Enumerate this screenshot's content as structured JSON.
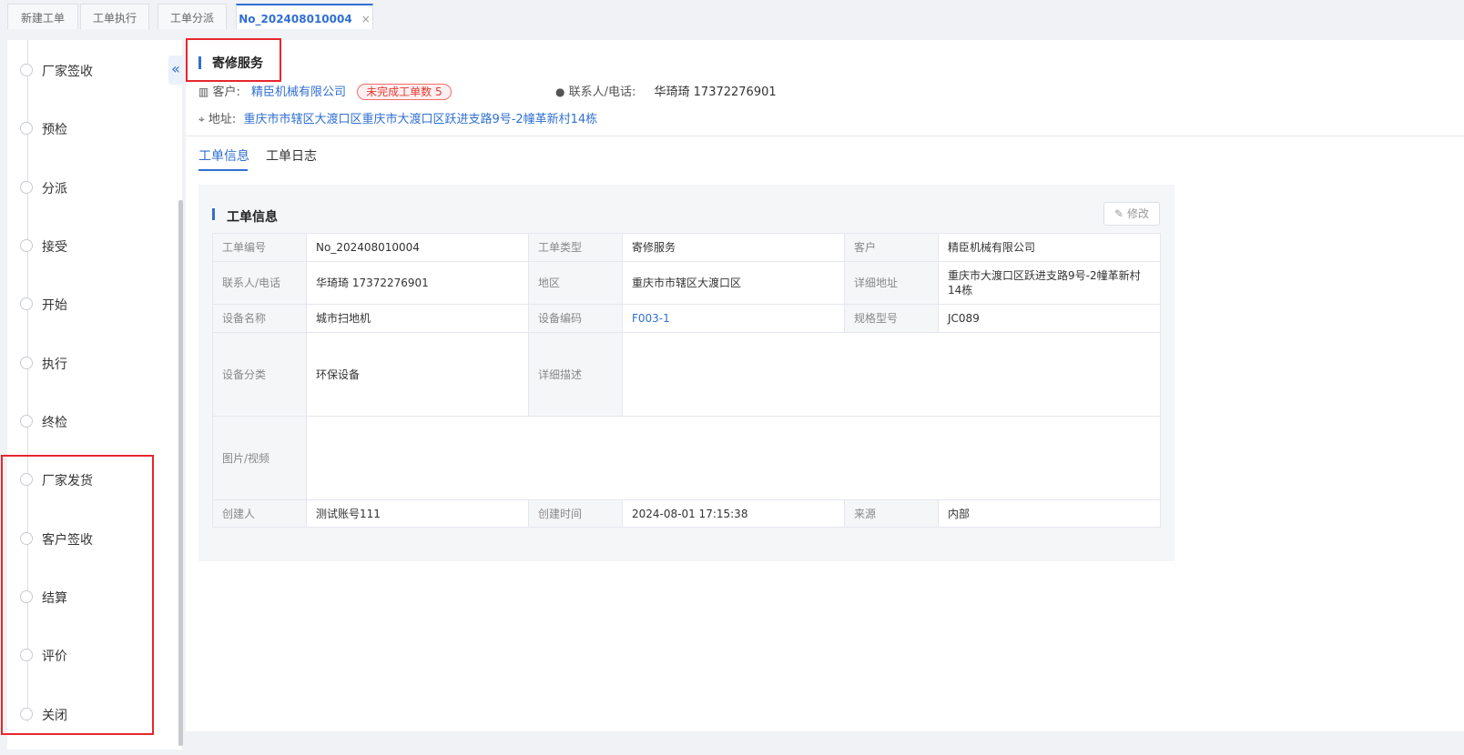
{
  "tabs": [
    {
      "label": "新建工单"
    },
    {
      "label": "工单执行"
    },
    {
      "label": "工单分派"
    },
    {
      "label": "No_202408010004",
      "close": "×"
    }
  ],
  "steps": [
    "厂家签收",
    "预检",
    "分派",
    "接受",
    "开始",
    "执行",
    "终检",
    "厂家发货",
    "客户签收",
    "结算",
    "评价",
    "关闭"
  ],
  "collapse_icon": "«",
  "header": {
    "service_type": "寄修服务",
    "customer_label": "客户:",
    "customer_name": "精臣机械有限公司",
    "badge": "未完成工单数 5",
    "contact_label": "联系人/电话:",
    "contact_value": "华琦琦 17372276901",
    "address_label": "地址:",
    "address_value": "重庆市市辖区大渡口区重庆市大渡口区跃进支路9号-2幢革新村14栋"
  },
  "subtabs": [
    "工单信息",
    "工单日志"
  ],
  "panel": {
    "title": "工单信息",
    "edit_label": "修改",
    "edit_icon": "✎"
  },
  "info": {
    "r1": {
      "k1": "工单编号",
      "v1": "No_202408010004",
      "k2": "工单类型",
      "v2": "寄修服务",
      "k3": "客户",
      "v3": "精臣机械有限公司"
    },
    "r2": {
      "k1": "联系人/电话",
      "v1": "华琦琦 17372276901",
      "k2": "地区",
      "v2": "重庆市市辖区大渡口区",
      "k3": "详细地址",
      "v3": "重庆市大渡口区跃进支路9号-2幢革新村14栋"
    },
    "r3": {
      "k1": "设备名称",
      "v1": "城市扫地机",
      "k2": "设备编码",
      "v2": "F003-1",
      "k3": "规格型号",
      "v3": "JC089"
    },
    "r4": {
      "k1": "设备分类",
      "v1": "环保设备",
      "k2": "详细描述",
      "v2": ""
    },
    "r5": {
      "k1": "图片/视频",
      "v1": ""
    },
    "r6": {
      "k1": "创建人",
      "v1": "测试账号111",
      "k2": "创建时间",
      "v2": "2024-08-01 17:15:38",
      "k3": "来源",
      "v3": "内部"
    }
  },
  "colors": {
    "accent": "#2f6fd2",
    "highlight": "#e8262d",
    "badge": "#e53935"
  }
}
